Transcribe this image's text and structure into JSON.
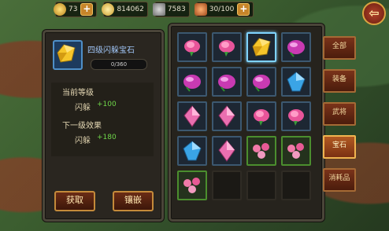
{
  "resources": [
    {
      "name": "gold-ingot",
      "value": "73"
    },
    {
      "name": "coin",
      "value": "814062"
    },
    {
      "name": "hammer",
      "value": "7583"
    },
    {
      "name": "food",
      "value": "30/100"
    }
  ],
  "detail": {
    "item_name": "四级闪躲宝石",
    "progress": "0/360",
    "progress_fraction": 0,
    "current_title": "当前等级",
    "current_stat": "闪躲",
    "current_value": "+100",
    "next_title": "下一级效果",
    "next_stat": "闪躲",
    "next_value": "+180",
    "obtain_label": "获取",
    "inlay_label": "镶嵌"
  },
  "tabs": [
    "全部",
    "装备",
    "武将",
    "宝石",
    "消耗品"
  ],
  "active_tab": "宝石",
  "inventory": [
    {
      "gem": "pink-rose",
      "slot": "blue"
    },
    {
      "gem": "pink-rose",
      "slot": "blue"
    },
    {
      "gem": "yellow-gem",
      "slot": "selected"
    },
    {
      "gem": "magenta-gem",
      "slot": "blue"
    },
    {
      "gem": "magenta-gem",
      "slot": "blue"
    },
    {
      "gem": "magenta-gem",
      "slot": "blue"
    },
    {
      "gem": "magenta-gem",
      "slot": "blue"
    },
    {
      "gem": "blue-gem",
      "slot": "blue"
    },
    {
      "gem": "pink-crystal",
      "slot": "blue"
    },
    {
      "gem": "pink-crystal",
      "slot": "blue"
    },
    {
      "gem": "pink-rose",
      "slot": "blue"
    },
    {
      "gem": "pink-rose",
      "slot": "blue"
    },
    {
      "gem": "blue-gem",
      "slot": "blue"
    },
    {
      "gem": "pink-crystal",
      "slot": "blue"
    },
    {
      "gem": "pink-flowers",
      "slot": "green"
    },
    {
      "gem": "pink-flowers",
      "slot": "green"
    },
    {
      "gem": "pink-flowers",
      "slot": "green"
    },
    {
      "gem": "",
      "slot": "empty"
    },
    {
      "gem": "",
      "slot": "empty"
    },
    {
      "gem": "",
      "slot": "empty"
    }
  ],
  "colors": {
    "accent": "#f0b450",
    "green_value": "#6fd64a",
    "item_title": "#9fc4f5"
  }
}
